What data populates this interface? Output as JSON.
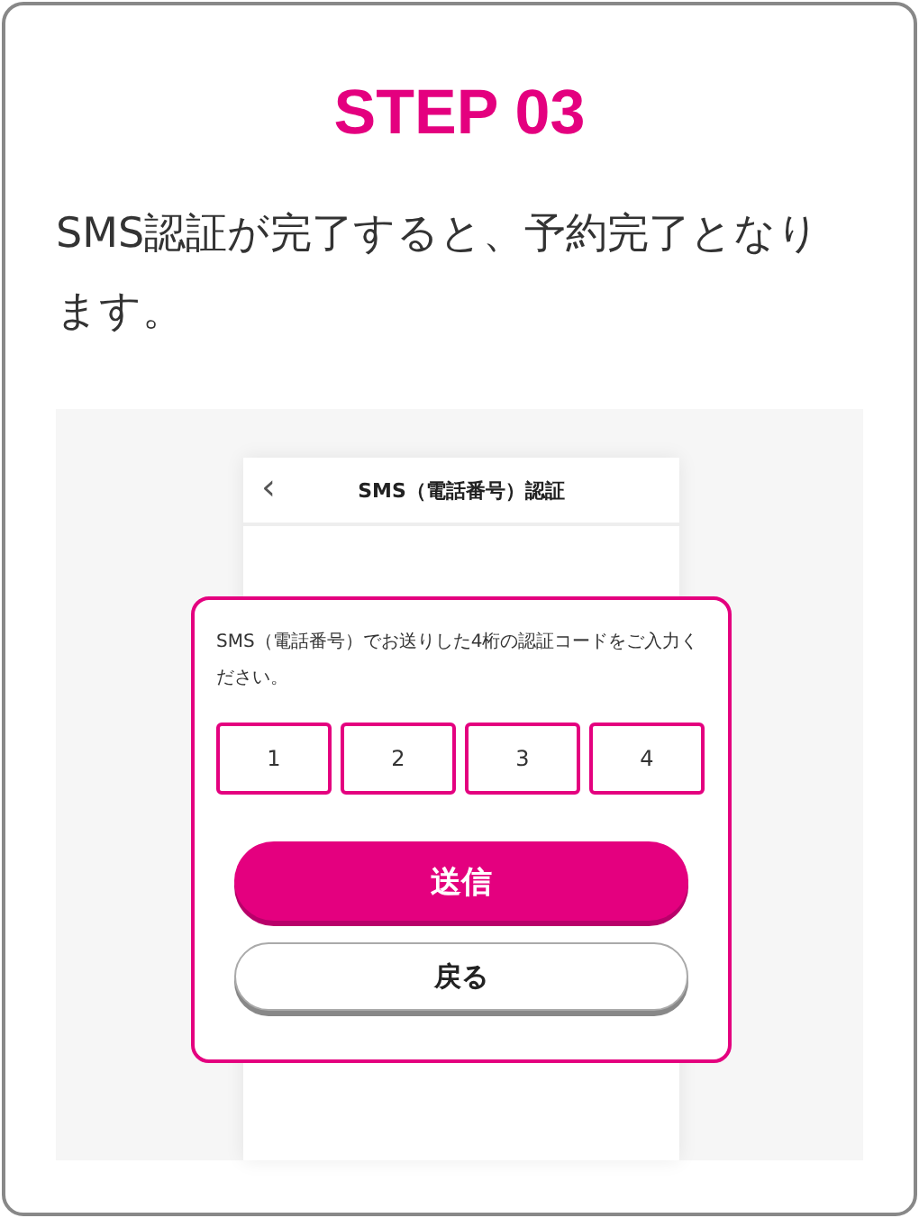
{
  "step_title": "STEP 03",
  "description": "SMS認証が完了すると、予約完了となります。",
  "phone": {
    "back": "‹",
    "title": "SMS（電話番号）認証"
  },
  "dialog": {
    "message": "SMS（電話番号）でお送りした4桁の認証コードをご入力ください。",
    "code_digits": [
      "1",
      "2",
      "3",
      "4"
    ],
    "buttons": [
      {
        "label": "送信",
        "kind": "primary"
      },
      {
        "label": "戻る",
        "kind": "secondary"
      }
    ]
  }
}
